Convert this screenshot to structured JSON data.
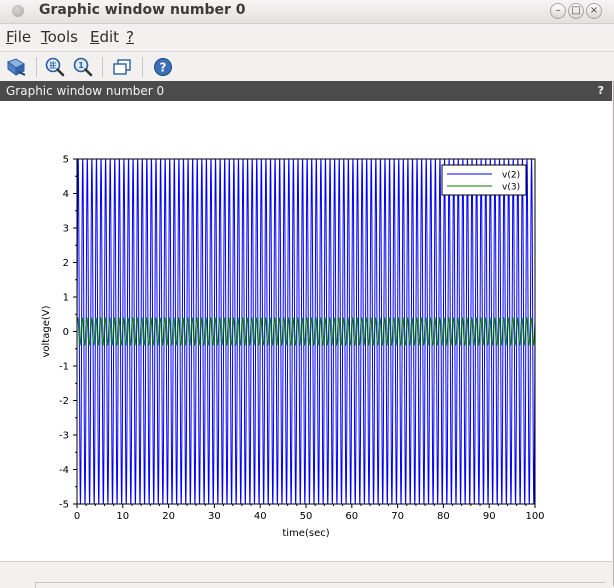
{
  "window": {
    "title": "Graphic window number 0"
  },
  "window_buttons": {
    "minimize": "–",
    "maximize": "□",
    "close": "×"
  },
  "menu": [
    {
      "label": "File",
      "mnemonic": "F",
      "rest": "ile"
    },
    {
      "label": "Tools",
      "mnemonic": "T",
      "rest": "ools"
    },
    {
      "label": "Edit",
      "mnemonic": "E",
      "rest": "dit"
    },
    {
      "label": "?",
      "mnemonic": "?",
      "rest": ""
    }
  ],
  "toolbar": {
    "icons": [
      "rotate-icon",
      "zoom-in-icon",
      "zoom-original-icon",
      "datatip-icon",
      "help-icon"
    ]
  },
  "panel": {
    "title": "Graphic window number 0",
    "help": "?"
  },
  "chart_data": {
    "type": "line",
    "xlabel": "time(sec)",
    "ylabel": "voltage(V)",
    "xlim": [
      0,
      100
    ],
    "ylim": [
      -5,
      5
    ],
    "xticks": [
      0,
      10,
      20,
      30,
      40,
      50,
      60,
      70,
      80,
      90,
      100
    ],
    "yticks": [
      -5,
      -4,
      -3,
      -2,
      -1,
      0,
      1,
      2,
      3,
      4,
      5
    ],
    "grid": false,
    "legend_position": "top-right",
    "series": [
      {
        "name": "v(2)",
        "color": "#0000ff",
        "amplitude": 5,
        "cycles": 100,
        "description": "sinusoid"
      },
      {
        "name": "v(3)",
        "color": "#007a00",
        "amplitude": 0.4,
        "cycles": 100,
        "description": "sinusoid"
      }
    ]
  }
}
